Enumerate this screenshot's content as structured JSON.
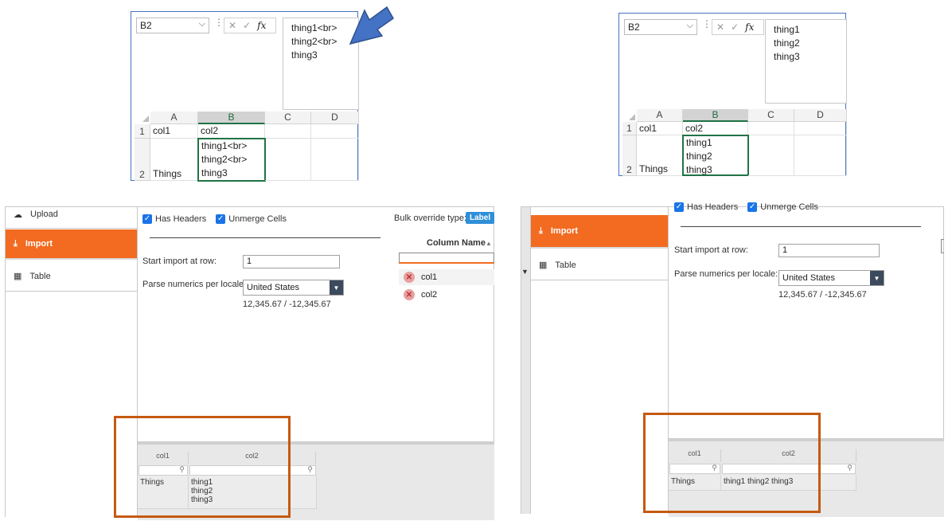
{
  "left_excel": {
    "name_box": "B2",
    "formula_lines": [
      "thing1<br>",
      "thing2<br>",
      "thing3"
    ],
    "col_headers": [
      "A",
      "B",
      "C",
      "D"
    ],
    "row_headers": [
      "1",
      "2"
    ],
    "cells": {
      "a1": "col1",
      "b1": "col2",
      "a2": "Things",
      "b2_lines": [
        "thing1<br>",
        "thing2<br>",
        "thing3"
      ]
    }
  },
  "right_excel": {
    "name_box": "B2",
    "formula_lines": [
      "thing1",
      "thing2",
      "thing3"
    ],
    "col_headers": [
      "A",
      "B",
      "C",
      "D"
    ],
    "row_headers": [
      "1",
      "2"
    ],
    "cells": {
      "a1": "col1",
      "b1": "col2",
      "a2": "Things",
      "b2_lines": [
        "thing1",
        "thing2",
        "thing3"
      ]
    }
  },
  "icons": {
    "fx": "fx",
    "cancel": "✕",
    "enter": "✓",
    "chevron": "⌵"
  },
  "left_app": {
    "sidebar": [
      "Upload",
      "Import",
      "Table"
    ],
    "has_headers": "Has Headers",
    "unmerge_cells": "Unmerge Cells",
    "bulk_override_label": "Bulk override type:",
    "bulk_override_badge": "Label",
    "column_name_header": "Column Name",
    "columns": [
      "col1",
      "col2"
    ],
    "start_row_label": "Start import at row:",
    "start_row_value": "1",
    "locale_label": "Parse numerics per locale:",
    "locale_value": "United States",
    "locale_example": "12,345.67 / -12,345.67",
    "grid_headers": [
      "col1",
      "col2"
    ],
    "grid_row": {
      "col1": "Things",
      "col2_lines": [
        "thing1",
        "thing2",
        "thing3"
      ]
    }
  },
  "right_app": {
    "sidebar": [
      "Import",
      "Table"
    ],
    "has_headers": "Has Headers",
    "unmerge_cells": "Unmerge Cells",
    "start_row_label": "Start import at row:",
    "start_row_value": "1",
    "locale_label": "Parse numerics per locale:",
    "locale_value": "United States",
    "locale_example": "12,345.67 / -12,345.67",
    "grid_headers": [
      "col1",
      "col2"
    ],
    "grid_row": {
      "col1": "Things",
      "col2": "thing1 thing2 thing3"
    }
  },
  "colors": {
    "excel_green": "#217346",
    "accent_orange": "#f26b21",
    "highlight_box": "#c55a11",
    "arrow_blue": "#4472c4"
  }
}
